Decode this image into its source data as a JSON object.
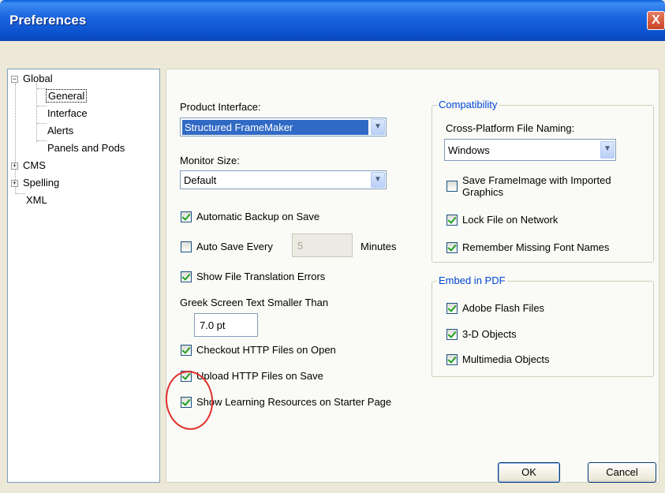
{
  "window": {
    "title": "Preferences",
    "close_label": "X"
  },
  "tree": {
    "global": "Global",
    "general": "General",
    "interface": "Interface",
    "alerts": "Alerts",
    "panels_and_pods": "Panels and Pods",
    "cms": "CMS",
    "spelling": "Spelling",
    "xml": "XML",
    "expanded_glyph": "−",
    "collapsed_glyph": "+"
  },
  "general": {
    "product_interface_label": "Product Interface:",
    "product_interface_value": "Structured FrameMaker",
    "monitor_size_label": "Monitor Size:",
    "monitor_size_value": "Default",
    "automatic_backup": {
      "label": "Automatic Backup on Save",
      "checked": true
    },
    "auto_save": {
      "label": "Auto Save Every",
      "checked": false,
      "value": "5",
      "unit": "Minutes"
    },
    "show_translation_errors": {
      "label": "Show File Translation Errors",
      "checked": true
    },
    "greek_label": "Greek Screen Text Smaller Than",
    "greek_value": "7.0 pt",
    "checkout_http": {
      "label": "Checkout HTTP Files on Open",
      "checked": true
    },
    "upload_http": {
      "label": "Upload HTTP Files on Save",
      "checked": true
    },
    "show_learning": {
      "label": "Show Learning Resources on Starter Page",
      "checked": true
    }
  },
  "compatibility": {
    "title": "Compatibility",
    "naming_label": "Cross-Platform File Naming:",
    "naming_value": "Windows",
    "save_frameimage": {
      "label_line1": "Save FrameImage with Imported",
      "label_line2": "Graphics",
      "checked": false
    },
    "lock_file": {
      "label": "Lock File on Network",
      "checked": true
    },
    "remember_fonts": {
      "label": "Remember Missing Font Names",
      "checked": true
    }
  },
  "embed_pdf": {
    "title": "Embed in PDF",
    "flash": {
      "label": "Adobe Flash Files",
      "checked": true
    },
    "objects_3d": {
      "label": "3-D Objects",
      "checked": true
    },
    "multimedia": {
      "label": "Multimedia Objects",
      "checked": true
    }
  },
  "buttons": {
    "ok": "OK",
    "cancel": "Cancel"
  },
  "colors": {
    "title_bar": "#1b66e0",
    "selection": "#316ac5",
    "group_title": "#0046d5",
    "annotation": "#e0302a",
    "check": "#21a121"
  }
}
